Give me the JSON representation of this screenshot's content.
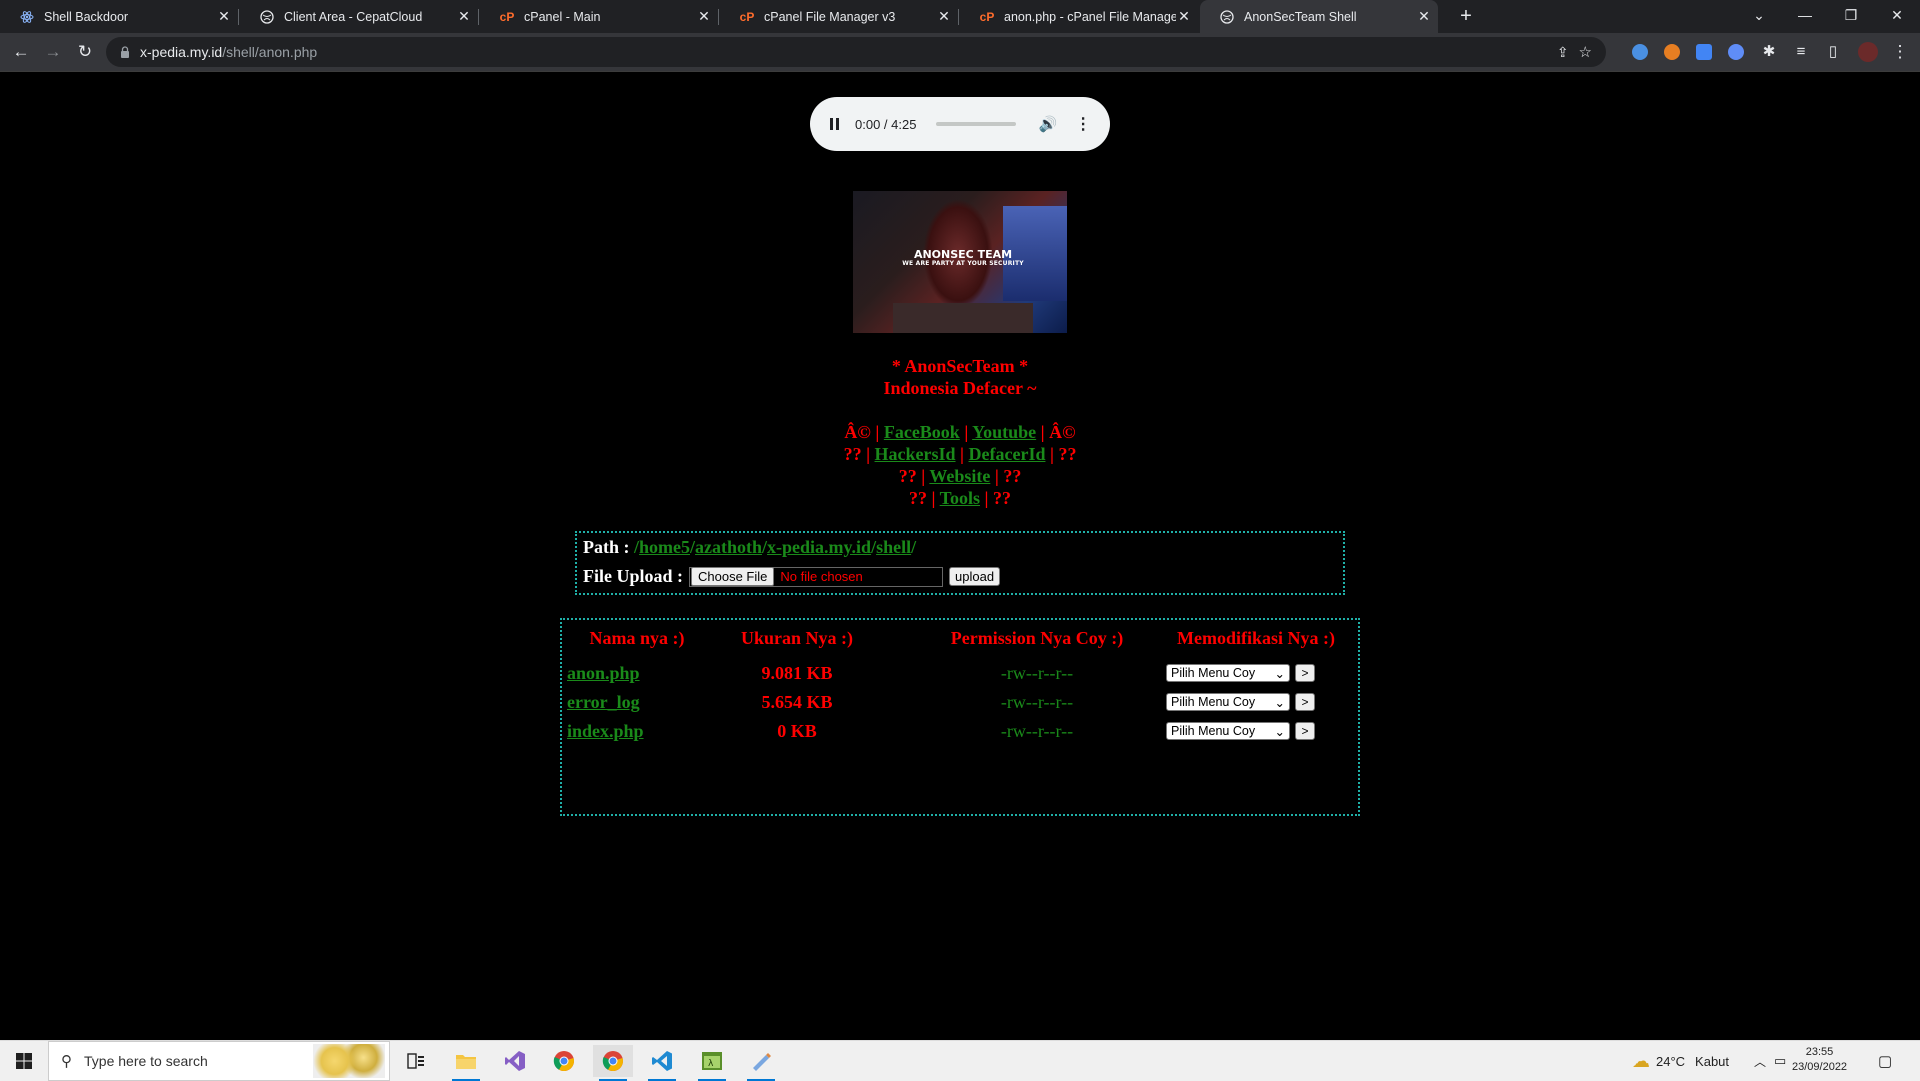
{
  "browser": {
    "tabs": [
      {
        "title": "Shell Backdoor",
        "icon": "react-icon"
      },
      {
        "title": "Client Area - CepatCloud",
        "icon": "globe-icon"
      },
      {
        "title": "cPanel - Main",
        "icon": "cpanel-icon"
      },
      {
        "title": "cPanel File Manager v3",
        "icon": "cpanel-icon"
      },
      {
        "title": "anon.php - cPanel File Manager v",
        "icon": "cpanel-icon"
      },
      {
        "title": "AnonSecTeam Shell",
        "icon": "globe-icon"
      }
    ],
    "active_tab": 5,
    "url_host": "x-pedia.my.id",
    "url_path": "/shell/anon.php"
  },
  "audio": {
    "time": "0:00 / 4:25"
  },
  "banner": {
    "title": "ANONSEC TEAM",
    "subtitle": "WE ARE PARTY AT YOUR SECURITY"
  },
  "header": {
    "line1": "* AnonSecTeam *",
    "line2": "Indonesia Defacer ~"
  },
  "links": {
    "sym1": "Â©",
    "facebook": "FaceBook",
    "youtube": "Youtube",
    "sym2": "??",
    "hackersid": "HackersId",
    "defacerid": "DefacerId",
    "website": "Website",
    "tools": "Tools",
    "pipe": "|"
  },
  "path": {
    "label": "Path :",
    "segments": [
      "home5",
      "azathoth",
      "x-pedia.my.id",
      "shell"
    ],
    "slash": "/",
    "upload_label": "File Upload :",
    "choose_label": "Choose File",
    "no_file": "No file chosen",
    "upload_button": "upload"
  },
  "table": {
    "headers": [
      "Nama nya :)",
      "Ukuran Nya :)",
      "Permission Nya Coy :)",
      "Memodifikasi Nya :)"
    ],
    "rows": [
      {
        "name": "anon.php",
        "size": "9.081 KB",
        "perm": "-rw--r--r--"
      },
      {
        "name": "error_log",
        "size": "5.654 KB",
        "perm": "-rw--r--r--"
      },
      {
        "name": "index.php",
        "size": "0 KB",
        "perm": "-rw--r--r--"
      }
    ],
    "select_label": "Pilih Menu Coy",
    "go_label": ">"
  },
  "taskbar": {
    "search_placeholder": "Type here to search",
    "weather_temp": "24°C",
    "weather_desc": "Kabut",
    "time": "23:55",
    "date": "23/09/2022"
  },
  "colors": {
    "red": "#ff0000",
    "green": "#1a8a1a",
    "border": "#1fb0a8"
  }
}
